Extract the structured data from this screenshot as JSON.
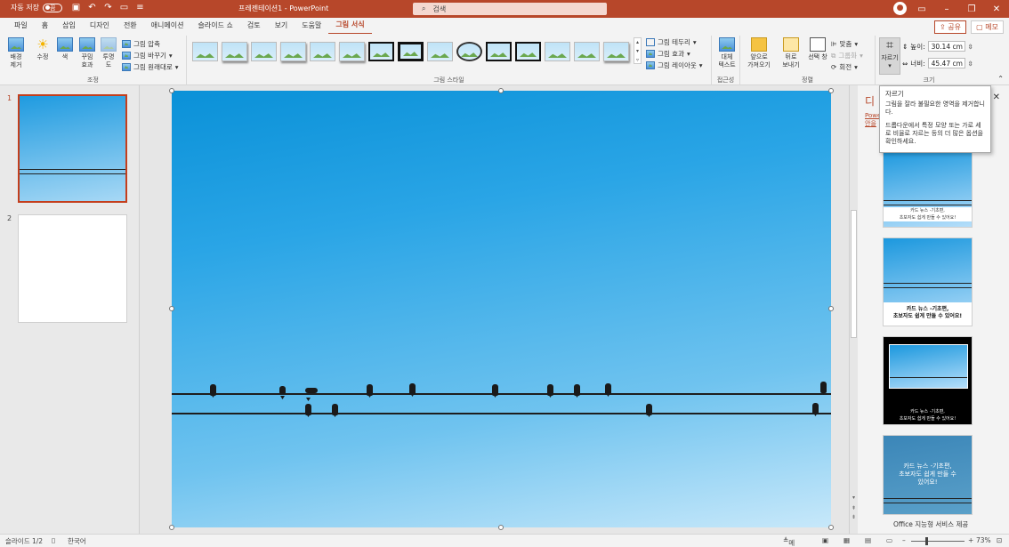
{
  "titlebar": {
    "autosave_label": "자동 저장",
    "autosave_state": "끔",
    "doc_title": "프레젠테이션1  -  PowerPoint",
    "search_placeholder": "검색",
    "avatar_letter": "●"
  },
  "menu": {
    "tabs": [
      "파일",
      "홈",
      "삽입",
      "디자인",
      "전환",
      "애니메이션",
      "슬라이드 쇼",
      "검토",
      "보기",
      "도움말",
      "그림 서식"
    ],
    "active": "그림 서식",
    "share": "공유",
    "memo": "메모"
  },
  "ribbon": {
    "adjust": {
      "remove_bg": "배경\n제거",
      "corrections": "수정",
      "color": "색",
      "artistic": "꾸밈\n효과",
      "transparency": "투명\n도",
      "compress": "그림 압축",
      "change": "그림 바꾸기",
      "reset": "그림 원래대로",
      "label": "조정"
    },
    "styles": {
      "label": "그림 스타일",
      "border": "그림 테두리",
      "effects": "그림 효과",
      "layout": "그림 레이아웃"
    },
    "accessibility": {
      "alt_text": "대체\n텍스트",
      "label": "접근성"
    },
    "arrange": {
      "bring_forward": "앞으로\n가져오기",
      "send_backward": "뒤로\n보내기",
      "selection_pane": "선택 창",
      "align": "맞춤",
      "group": "그룹화",
      "rotate": "회전",
      "label": "정렬"
    },
    "size": {
      "crop": "자르기",
      "height_label": "높이:",
      "height_value": "30.14 cm",
      "width_label": "너비:",
      "width_value": "45.47 cm",
      "label": "크기"
    }
  },
  "tooltip": {
    "title": "자르기",
    "line1": "그림을 잘라 불필요한 영역을 제거합니다.",
    "line2": "드롭다운에서 특정 모양 또는 가로 세로 비율로 자르는 등의 더 많은 옵션을 확인하세요."
  },
  "thumbnails": {
    "slide1": "1",
    "slide2": "2"
  },
  "designer": {
    "title": "디",
    "link": "Powe\n안을",
    "option_caption_small": "카드 뉴스 -기초편,\n초보자도 쉽게 만들 수 있어요!",
    "option_caption_mid": "카드 뉴스 -기초편,\n초보자도 쉽게 만들 수 있어요!",
    "option_caption_dark": "카드 뉴스 -기초편,\n초보자도 쉽게 만들 수 있어요!",
    "option_caption_large": "카드 뉴스 -기초편,\n초보자도 쉽게 만들 수\n있어요!",
    "footer": "Office 지능형 서비스 제공"
  },
  "status": {
    "slide_indicator": "슬라이드 1/2",
    "language": "한국어",
    "notes": "메모",
    "zoom": "73%"
  }
}
